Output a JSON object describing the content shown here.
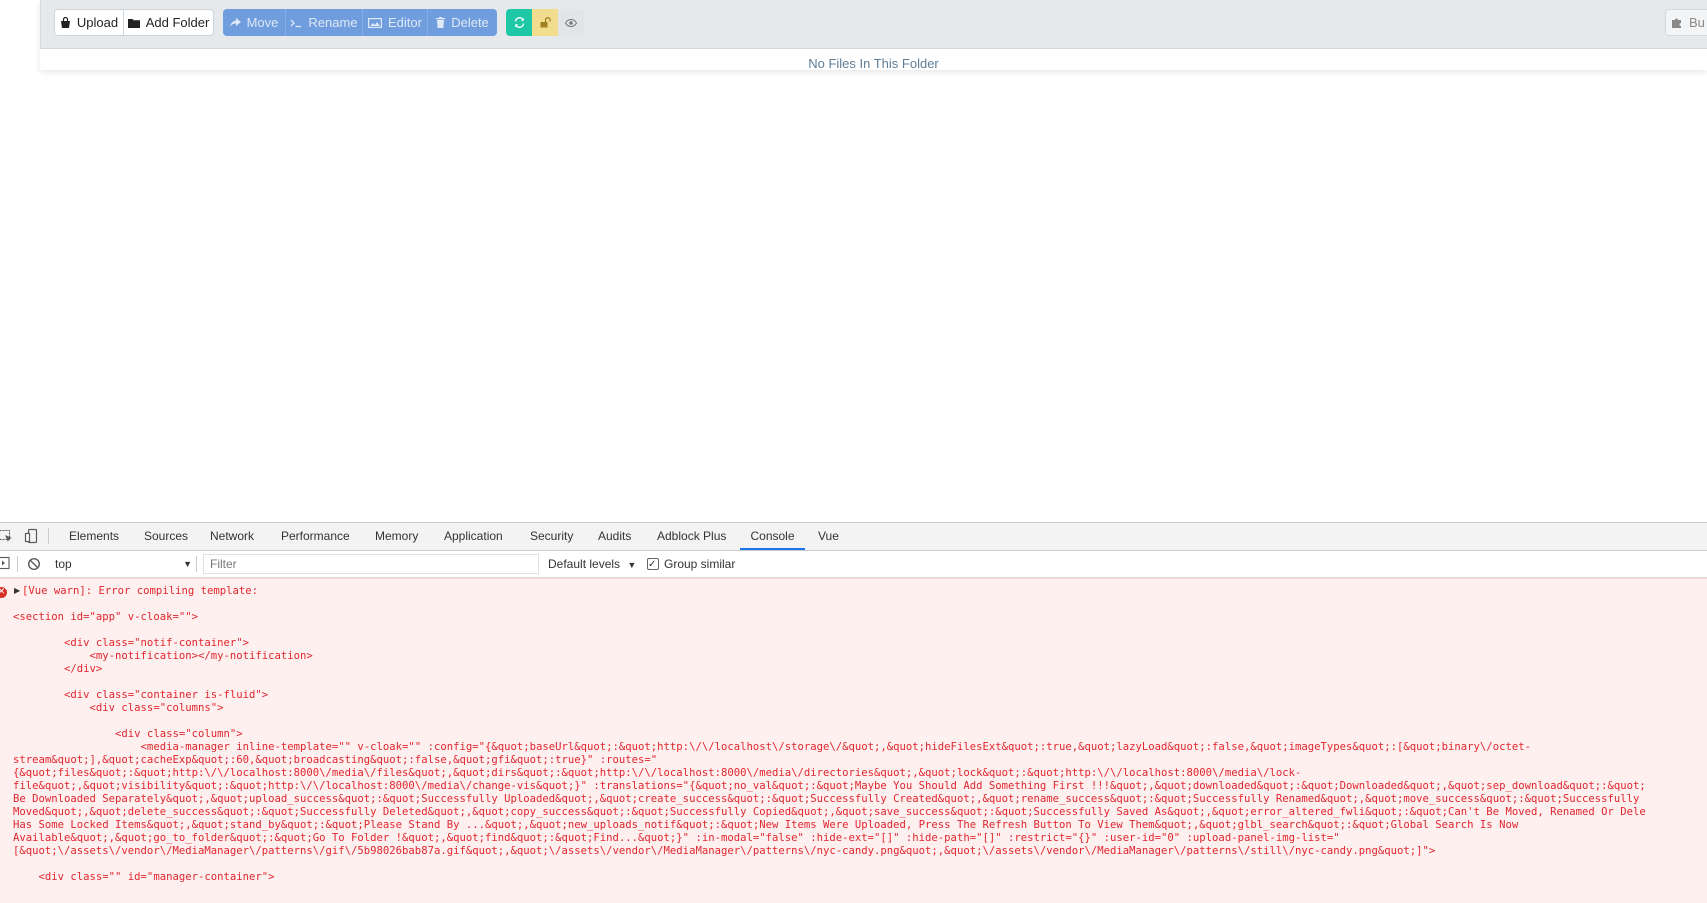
{
  "toolbar": {
    "upload_label": "Upload",
    "add_folder_label": "Add Folder",
    "move_label": "Move",
    "rename_label": "Rename",
    "editor_label": "Editor",
    "delete_label": "Delete",
    "bulk_label": "Bu"
  },
  "main": {
    "empty_message": "No Files In This Folder"
  },
  "devtools": {
    "tabs": [
      "Elements",
      "Sources",
      "Network",
      "Performance",
      "Memory",
      "Application",
      "Security",
      "Audits",
      "Adblock Plus",
      "Console",
      "Vue"
    ],
    "active_tab": "Console",
    "context": "top",
    "filter_placeholder": "Filter",
    "levels_label": "Default levels",
    "group_similar_label": "Group similar",
    "console_message": "[Vue warn]: Error compiling template:\n\n<section id=\"app\" v-cloak=\"\">\n\n        <div class=\"notif-container\">\n            <my-notification></my-notification>\n        </div>\n\n        <div class=\"container is-fluid\">\n            <div class=\"columns\">\n\n                <div class=\"column\">\n                    <media-manager inline-template=\"\" v-cloak=\"\" :config=\"{&quot;baseUrl&quot;:&quot;http:\\/\\/localhost\\/storage\\/&quot;,&quot;hideFilesExt&quot;:true,&quot;lazyLoad&quot;:false,&quot;imageTypes&quot;:[&quot;binary\\/octet-\nstream&quot;],&quot;cacheExp&quot;:60,&quot;broadcasting&quot;:false,&quot;gfi&quot;:true}\" :routes=\"\n{&quot;files&quot;:&quot;http:\\/\\/localhost:8000\\/media\\/files&quot;,&quot;dirs&quot;:&quot;http:\\/\\/localhost:8000\\/media\\/directories&quot;,&quot;lock&quot;:&quot;http:\\/\\/localhost:8000\\/media\\/lock-\nfile&quot;,&quot;visibility&quot;:&quot;http:\\/\\/localhost:8000\\/media\\/change-vis&quot;}\" :translations=\"{&quot;no_val&quot;:&quot;Maybe You Should Add Something First !!!&quot;,&quot;downloaded&quot;:&quot;Downloaded&quot;,&quot;sep_download&quot;:&quot;\nBe Downloaded Separately&quot;,&quot;upload_success&quot;:&quot;Successfully Uploaded&quot;,&quot;create_success&quot;:&quot;Successfully Created&quot;,&quot;rename_success&quot;:&quot;Successfully Renamed&quot;,&quot;move_success&quot;:&quot;Successfully\nMoved&quot;,&quot;delete_success&quot;:&quot;Successfully Deleted&quot;,&quot;copy_success&quot;:&quot;Successfully Copied&quot;,&quot;save_success&quot;:&quot;Successfully Saved As&quot;,&quot;error_altered_fwli&quot;:&quot;Can't Be Moved, Renamed Or Dele\nHas Some Locked Items&quot;,&quot;stand_by&quot;:&quot;Please Stand By ...&quot;,&quot;new_uploads_notif&quot;:&quot;New Items Were Uploaded, Press The Refresh Button To View Them&quot;,&quot;glbl_search&quot;:&quot;Global Search Is Now\nAvailable&quot;,&quot;go_to_folder&quot;:&quot;Go To Folder !&quot;,&quot;find&quot;:&quot;Find...&quot;}\" :in-modal=\"false\" :hide-ext=\"[]\" :hide-path=\"[]\" :restrict=\"{}\" :user-id=\"0\" :upload-panel-img-list=\"\n[&quot;\\/assets\\/vendor\\/MediaManager\\/patterns\\/gif\\/5b98026bab87a.gif&quot;,&quot;\\/assets\\/vendor\\/MediaManager\\/patterns\\/nyc-candy.png&quot;,&quot;\\/assets\\/vendor\\/MediaManager\\/patterns\\/still\\/nyc-candy.png&quot;]\">\n\n    <div class=\"\" id=\"manager-container\">"
  }
}
